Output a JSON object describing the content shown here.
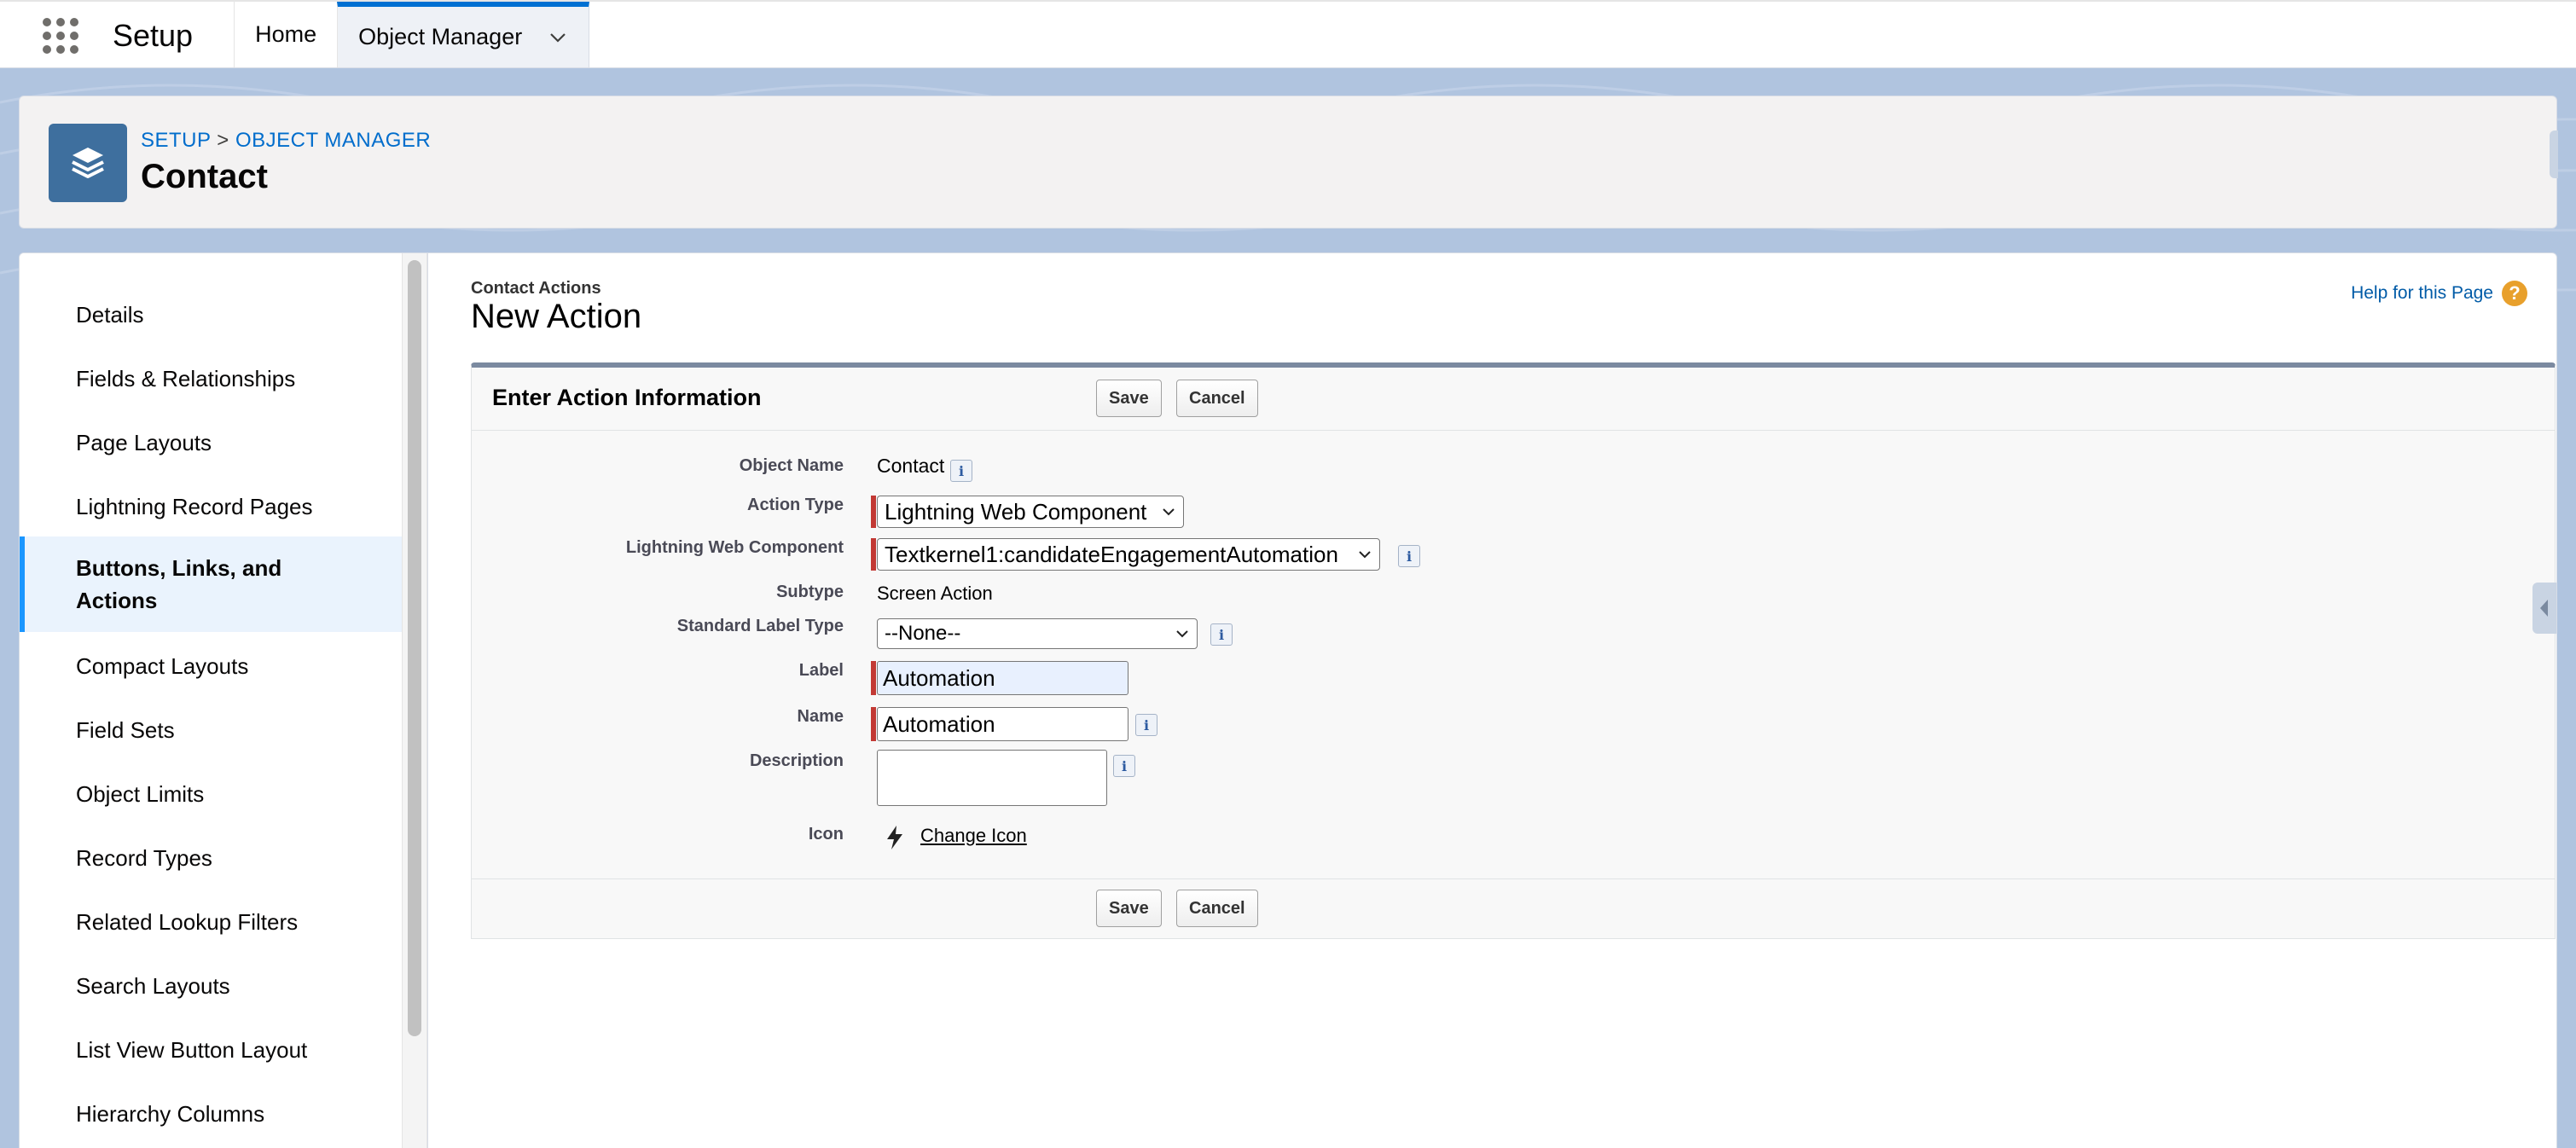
{
  "app": {
    "name": "Setup",
    "tabs": [
      {
        "label": "Home"
      },
      {
        "label": "Object Manager"
      }
    ]
  },
  "header": {
    "breadcrumb": {
      "root": "SETUP",
      "separator": ">",
      "current": "OBJECT MANAGER"
    },
    "title": "Contact"
  },
  "sidebar": {
    "items": [
      {
        "label": "Details"
      },
      {
        "label": "Fields & Relationships"
      },
      {
        "label": "Page Layouts"
      },
      {
        "label": "Lightning Record Pages"
      },
      {
        "label": "Buttons, Links, and Actions",
        "active": true
      },
      {
        "label": "Compact Layouts"
      },
      {
        "label": "Field Sets"
      },
      {
        "label": "Object Limits"
      },
      {
        "label": "Record Types"
      },
      {
        "label": "Related Lookup Filters"
      },
      {
        "label": "Search Layouts"
      },
      {
        "label": "List View Button Layout"
      },
      {
        "label": "Hierarchy Columns"
      }
    ]
  },
  "content": {
    "crumb": "Contact Actions",
    "title": "New Action",
    "help": "Help for this Page",
    "block_title": "Enter Action Information",
    "save_label": "Save",
    "cancel_label": "Cancel",
    "fields": {
      "object_name": {
        "label": "Object Name",
        "value": "Contact"
      },
      "action_type": {
        "label": "Action Type",
        "value": "Lightning Web Component"
      },
      "lwc": {
        "label": "Lightning Web Component",
        "value": "Textkernel1:candidateEngagementAutomation"
      },
      "subtype": {
        "label": "Subtype",
        "value": "Screen Action"
      },
      "std_label_type": {
        "label": "Standard Label Type",
        "value": "--None--"
      },
      "label": {
        "label": "Label",
        "value": "Automation"
      },
      "name": {
        "label": "Name",
        "value": "Automation"
      },
      "description": {
        "label": "Description",
        "value": ""
      },
      "icon": {
        "label": "Icon",
        "link": "Change Icon"
      }
    }
  },
  "colors": {
    "accent": "#0070d2",
    "required": "#c23934",
    "object_icon": "#3e6f9e",
    "background_band": "#b0c4df"
  }
}
